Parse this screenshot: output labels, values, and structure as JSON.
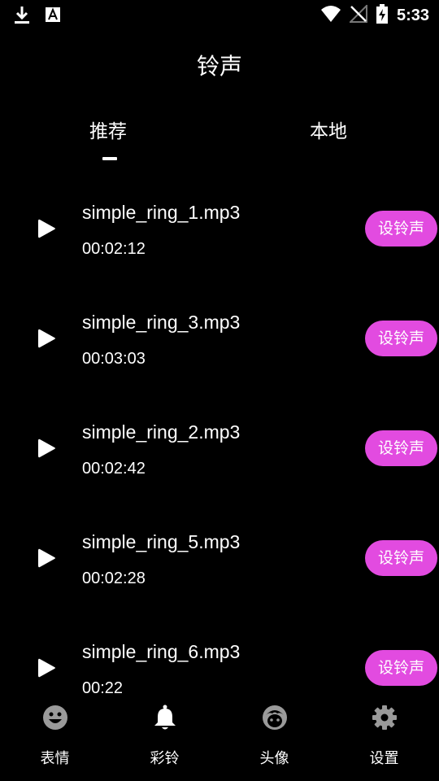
{
  "status": {
    "time": "5:33"
  },
  "page": {
    "title": "铃声"
  },
  "tabs": [
    {
      "label": "推荐",
      "active": true
    },
    {
      "label": "本地",
      "active": false
    }
  ],
  "songs": [
    {
      "name": "simple_ring_1.mp3",
      "duration": "00:02:12",
      "action": "设铃声"
    },
    {
      "name": "simple_ring_3.mp3",
      "duration": "00:03:03",
      "action": "设铃声"
    },
    {
      "name": "simple_ring_2.mp3",
      "duration": "00:02:42",
      "action": "设铃声"
    },
    {
      "name": "simple_ring_5.mp3",
      "duration": "00:02:28",
      "action": "设铃声"
    },
    {
      "name": "simple_ring_6.mp3",
      "duration": "00:22",
      "action": "设铃声"
    }
  ],
  "nav": [
    {
      "label": "表情",
      "icon": "smiley-icon",
      "active": false
    },
    {
      "label": "彩铃",
      "icon": "bell-icon",
      "active": true
    },
    {
      "label": "头像",
      "icon": "avatar-face-icon",
      "active": false
    },
    {
      "label": "设置",
      "icon": "gear-icon",
      "active": false
    }
  ],
  "colors": {
    "background": "#000000",
    "accent": "#e24be0",
    "inactive_icon": "#9a9a9a",
    "text": "#ffffff"
  }
}
